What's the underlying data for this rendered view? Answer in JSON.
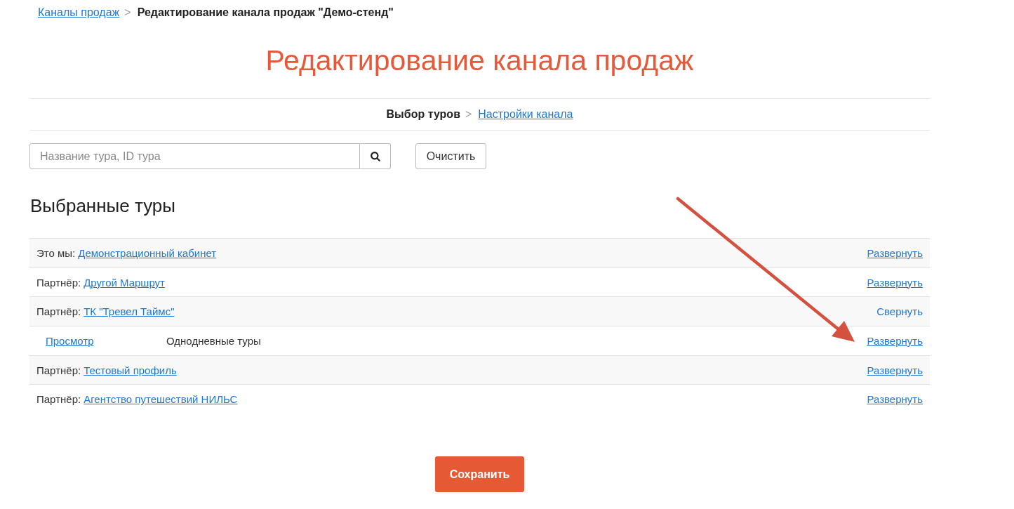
{
  "breadcrumb": {
    "separator": ">",
    "items": [
      {
        "kind": "link",
        "label": "Каналы продаж"
      },
      {
        "kind": "current",
        "label": "Редактирование канала продаж \"Демо-стенд\""
      }
    ]
  },
  "title": "Редактирование канала продаж",
  "steps": {
    "separator": ">",
    "items": [
      {
        "label": "Выбор туров",
        "selected": true
      },
      {
        "label": "Настройки канала",
        "selected": false
      }
    ]
  },
  "search": {
    "placeholder": "Название тура, ID тура"
  },
  "clear_button": "Очистить",
  "section_title": "Выбранные туры",
  "channels": [
    {
      "prefix": "Это мы:",
      "name": "Демонстрационный кабинет",
      "expanded": false,
      "toggle": "Развернуть"
    },
    {
      "prefix": "Партнёр:",
      "name": "Другой Маршрут",
      "expanded": false,
      "toggle": "Развернуть"
    },
    {
      "prefix": "Партнёр:",
      "name": "ТК \"Тревел Таймс\"",
      "expanded": true,
      "toggle": "Свернуть",
      "children": [
        {
          "view_link": "Просмотр",
          "name": "Однодневные туры",
          "expanded": false,
          "toggle": "Развернуть"
        }
      ]
    },
    {
      "prefix": "Партнёр:",
      "name": "Тестовый профиль",
      "expanded": false,
      "toggle": "Развернуть"
    },
    {
      "prefix": "Партнёр:",
      "name": "Агентство путешествий НИЛЬС",
      "expanded": false,
      "toggle": "Развернуть"
    }
  ],
  "save_button": "Сохранить",
  "annotations": [
    {
      "kind": "arrow"
    }
  ]
}
